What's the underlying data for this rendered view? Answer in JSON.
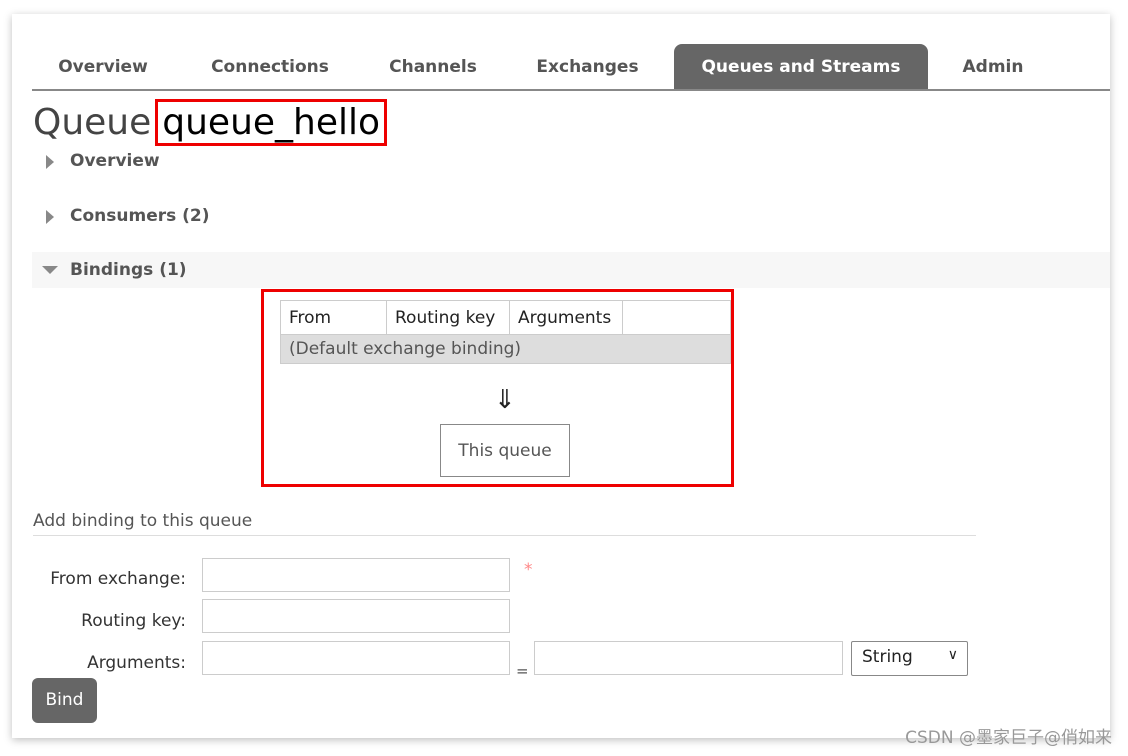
{
  "nav": {
    "tabs": [
      {
        "label": "Overview"
      },
      {
        "label": "Connections"
      },
      {
        "label": "Channels"
      },
      {
        "label": "Exchanges"
      },
      {
        "label": "Queues and Streams",
        "active": true
      },
      {
        "label": "Admin"
      }
    ]
  },
  "page": {
    "title_prefix": "Queue",
    "queue_name": "queue_hello"
  },
  "sections": {
    "overview": "Overview",
    "consumers": "Consumers (2)",
    "bindings": "Bindings (1)"
  },
  "bindings": {
    "headers": [
      "From",
      "Routing key",
      "Arguments",
      ""
    ],
    "rows": [
      {
        "from": "(Default exchange binding)"
      }
    ],
    "arrow": "⇓",
    "target": "This queue"
  },
  "add_binding": {
    "heading": "Add binding to this queue",
    "from_exchange_label": "From exchange:",
    "from_exchange_value": "",
    "required_mark": "*",
    "routing_key_label": "Routing key:",
    "routing_key_value": "",
    "arguments_label": "Arguments:",
    "arg_key_value": "",
    "equals": "=",
    "arg_value_value": "",
    "type_selected": "String",
    "bind_label": "Bind"
  },
  "watermark": "CSDN @墨家巨子@俏如来",
  "colors": {
    "highlight": "#ee0000",
    "active_tab": "#666666"
  }
}
